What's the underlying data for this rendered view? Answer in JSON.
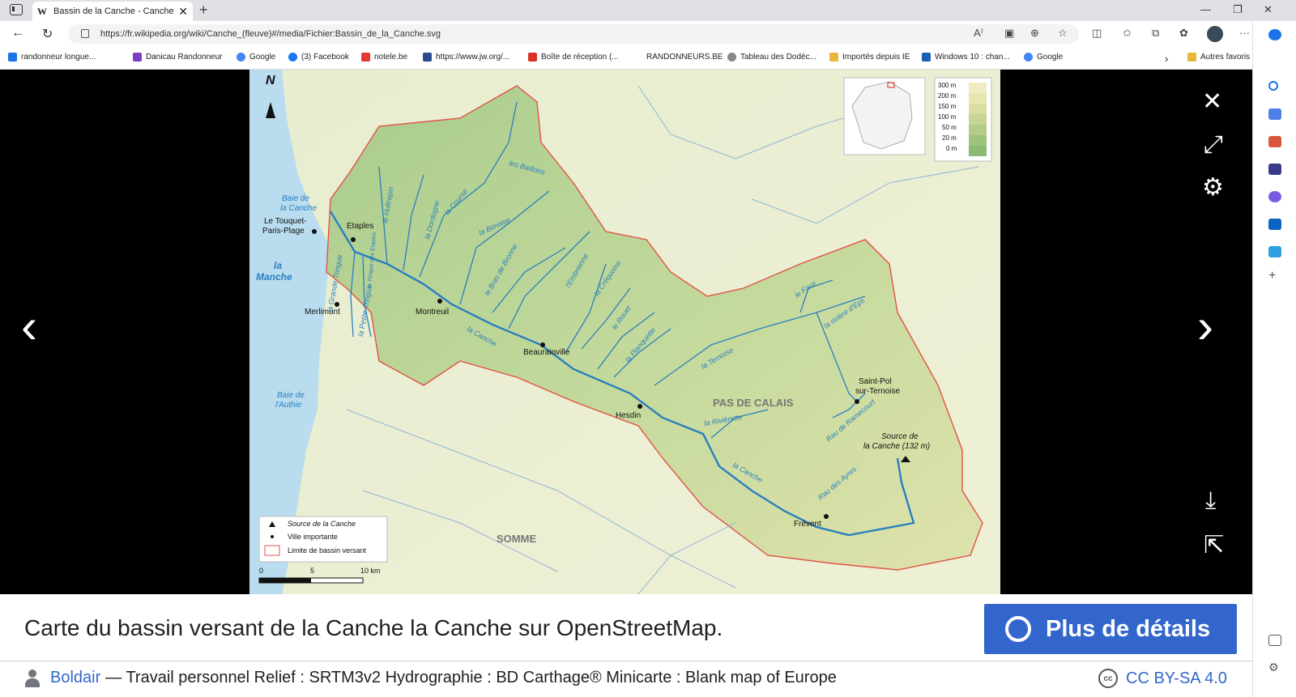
{
  "browser": {
    "tab_title": "Bassin de la Canche - Canche (fle",
    "tab_favicon": "W",
    "url": "https://fr.wikipedia.org/wiki/Canche_(fleuve)#/media/Fichier:Bassin_de_la_Canche.svg",
    "bookmarks": [
      {
        "label": "randonneur longue...",
        "color": "#1a73e8"
      },
      {
        "label": "Danicau Randonneur",
        "color": "#7a3fc4"
      },
      {
        "label": "Google",
        "color": "#4285f4"
      },
      {
        "label": "(3) Facebook",
        "color": "#1877f2"
      },
      {
        "label": "notele.be",
        "color": "#e53935"
      },
      {
        "label": "https://www.jw.org/...",
        "color": "#2b4a8b"
      },
      {
        "label": "Boîte de réception (...",
        "color": "#d93025"
      },
      {
        "label": "RANDONNEURS.BE",
        "color": "#ffffff"
      },
      {
        "label": "Tableau des Dodéc...",
        "color": "#888888"
      },
      {
        "label": "Importés depuis IE",
        "color": "#e8b73a"
      },
      {
        "label": "Windows 10 : chan...",
        "color": "#1b5fb8"
      },
      {
        "label": "Google",
        "color": "#4285f4"
      }
    ],
    "other_favorites": "Autres favoris"
  },
  "map": {
    "labels": {
      "north": "N",
      "baie_canche": [
        "Baie de",
        "la Canche"
      ],
      "touquet": [
        "Le Touquet-",
        "Paris-Plage"
      ],
      "etaples": "Etaples",
      "manche": [
        "la",
        "Manche"
      ],
      "merlimont": "Merlimont",
      "montreuil": "Montreuil",
      "beaurainville": "Beaurainville",
      "hesdin": "Hesdin",
      "saint_pol": [
        "Saint-Pol",
        "sur-Ternoise"
      ],
      "source": [
        "Source de",
        "la Canche (132 m)"
      ],
      "frevent": "Frévent",
      "baie_authie": [
        "Baie de",
        "l'Authie"
      ],
      "pas_de_calais": "PAS DE CALAIS",
      "somme": "SOMME",
      "rivers": [
        "le Hultrepin",
        "la Dordogne",
        "la Course",
        "les Baillons",
        "la Bimoise",
        "le Bras de Bronne",
        "l'Embrienne",
        "la Créquoise",
        "le Rouet",
        "la Planquette",
        "la Ternoise",
        "le Faux",
        "la rivière d'Eps",
        "la Rivièrette",
        "la Canche",
        "la Canche",
        "Rau de Ramecourt",
        "Rau des Ayres",
        "la Grande Tringue",
        "la Petite Tringue",
        "la Tringue des Etaples"
      ]
    },
    "legend": {
      "source": "Source de la Canche",
      "ville": "Ville importante",
      "limite": "Limite de bassin versant"
    },
    "scale": [
      "0",
      "5",
      "10 km"
    ],
    "elevation": [
      "300 m",
      "200 m",
      "150 m",
      "100 m",
      "50 m",
      "20 m",
      "0 m"
    ],
    "elevation_colors": [
      "#f1edc2",
      "#e6e6b0",
      "#d9dea0",
      "#c6d592",
      "#b4cd86",
      "#9fc37c",
      "#8bba74"
    ]
  },
  "caption": {
    "text": "Carte du bassin versant de la Canche la Canche sur OpenStreetMap.",
    "details_button": "Plus de détails",
    "author": "Boldair",
    "attribution": "— Travail personnel Relief : SRTM3v2 Hydrographie : BD Carthage® Minicarte : Blank map of Europe",
    "license": "CC BY-SA 4.0",
    "cc_glyph": "cc"
  },
  "colors": {
    "accent": "#3366cc",
    "border": "#e0524a",
    "river": "#2a7fbf",
    "sea": "#b9dcef"
  }
}
